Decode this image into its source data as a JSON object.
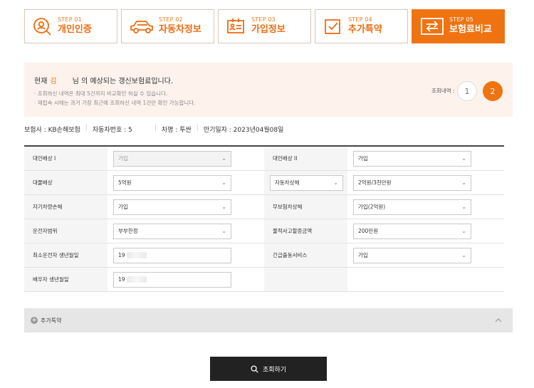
{
  "steps": [
    {
      "num": "STEP 01",
      "title": "개인인증",
      "icon": "person-search-icon"
    },
    {
      "num": "STEP 02",
      "title": "자동차정보",
      "icon": "car-icon"
    },
    {
      "num": "STEP 03",
      "title": "가입정보",
      "icon": "id-card-icon"
    },
    {
      "num": "STEP 04",
      "title": "추가특약",
      "icon": "checkbox-icon"
    },
    {
      "num": "STEP 05",
      "title": "보험료비교",
      "icon": "compare-arrows-icon"
    }
  ],
  "info": {
    "prefix": "현재",
    "name": "김",
    "suffix": "님 의 예상되는 갱신보험료입니다.",
    "note1": "· 조회하신 내역은 최대 5건까지 비교확인 하실 수 있습니다.",
    "note2": "· 재접속 시에는 과거 가장 최근에 조회하신 내역 1건만 확인 가능합니다.",
    "history_label": "조회내역 :",
    "history": [
      "1",
      "2"
    ]
  },
  "summary": {
    "insurer": "보험사 : KB손해보험",
    "car_no": "자동차번호 : 5",
    "car_name": "차명 : 투싼",
    "expiry": "만기일자 : 2023년04월08일"
  },
  "form": {
    "r1": {
      "l1": "대인배상 I",
      "v1": "가입",
      "l2": "대인배상 II",
      "v2": "가입"
    },
    "r2": {
      "l1": "대물배상",
      "v1": "5억원",
      "l2": "자동차상해",
      "v2": "2억원/3천만원"
    },
    "r3": {
      "l1": "자기차량손해",
      "v1": "가입",
      "l2": "무보험차상해",
      "v2": "가입(2억원)"
    },
    "r4": {
      "l1": "운전자범위",
      "v1": "부부한정",
      "l2": "물적사고할증금액",
      "v2": "200만원"
    },
    "r5": {
      "l1": "최소운전자 생년월일",
      "v1": "19",
      "l2": "긴급출동서비스",
      "v2": "가입"
    },
    "r6": {
      "l1": "배우자 생년월일",
      "v1": "19"
    }
  },
  "extra_label": "추가특약",
  "search_label": "조회하기",
  "colors": {
    "accent": "#f07312",
    "dark": "#222222"
  }
}
